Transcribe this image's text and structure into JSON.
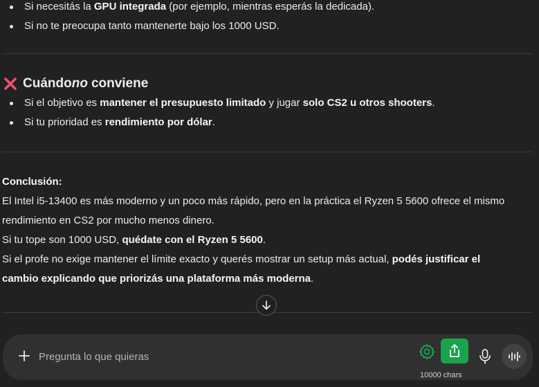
{
  "section_pros": {
    "items": [
      {
        "pre": "Si necesitás la ",
        "bold": "GPU integrada",
        "post": " (por ejemplo, mientras esperás la dedicada)."
      },
      {
        "text": "Si no te preocupa tanto mantenerte bajo los 1000 USD."
      }
    ]
  },
  "section_cons": {
    "heading_pre": "Cuándo ",
    "heading_em": "no",
    "heading_post": " conviene",
    "items": [
      {
        "a": "Si el objetivo es ",
        "b": "mantener el presupuesto limitado",
        "c": " y jugar ",
        "d": "solo CS2 u otros shooters",
        "e": "."
      },
      {
        "a": "Si tu prioridad es ",
        "b": "rendimiento por dólar",
        "c": "."
      }
    ]
  },
  "conclusion": {
    "label": "Conclusión:",
    "line1": "El Intel i5-13400 es más moderno y un poco más rápido, pero en la práctica el Ryzen 5 5600 ofrece el mismo",
    "line2": "rendimiento en CS2 por mucho menos dinero.",
    "line3_pre": "Si tu tope son 1000 USD, ",
    "line3_bold": "quédate con el Ryzen 5 5600",
    "line3_post": ".",
    "line4_pre": "Si el profe no exige mantener el límite exacto y querés mostrar un setup más actual, ",
    "line4_bold": "podés justificar el",
    "line5_bold": "cambio explicando que priorizás una plataforma más moderna",
    "line5_post": "."
  },
  "composer": {
    "placeholder": "Pregunta lo que quieras",
    "char_count": "10000 chars"
  },
  "colors": {
    "background": "#212121",
    "composer": "#303030",
    "accent_green": "#1aa34a",
    "cross_red": "#f0506e"
  },
  "icons": [
    "x-icon",
    "arrow-down-icon",
    "plus-icon",
    "gear-icon",
    "share-icon",
    "mic-icon",
    "voice-wave-icon"
  ]
}
